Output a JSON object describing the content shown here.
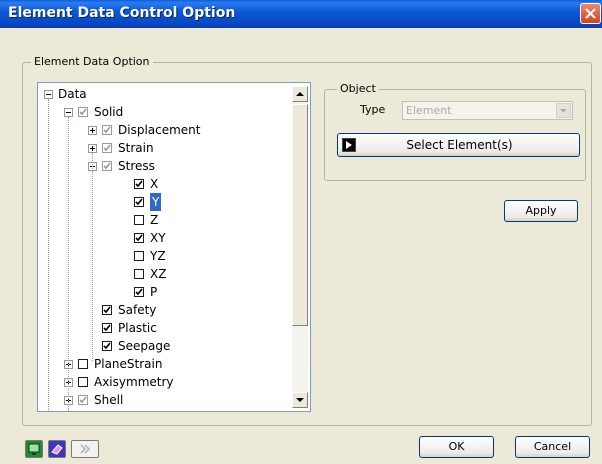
{
  "window": {
    "title": "Element Data Control Option"
  },
  "group": {
    "label": "Element Data Option"
  },
  "tree": [
    {
      "label": "Data",
      "level": 0,
      "expander": "minus",
      "checkbox": "none"
    },
    {
      "label": "Solid",
      "level": 1,
      "expander": "minus",
      "checkbox": "checked-gray"
    },
    {
      "label": "Displacement",
      "level": 2,
      "expander": "plus",
      "checkbox": "checked-gray"
    },
    {
      "label": "Strain",
      "level": 2,
      "expander": "plus",
      "checkbox": "checked-gray"
    },
    {
      "label": "Stress",
      "level": 2,
      "expander": "minus",
      "checkbox": "checked-gray"
    },
    {
      "label": "X",
      "level": 3,
      "expander": "none",
      "checkbox": "checked"
    },
    {
      "label": "Y",
      "level": 3,
      "expander": "none",
      "checkbox": "checked",
      "selected": true
    },
    {
      "label": "Z",
      "level": 3,
      "expander": "none",
      "checkbox": "unchecked"
    },
    {
      "label": "XY",
      "level": 3,
      "expander": "none",
      "checkbox": "checked"
    },
    {
      "label": "YZ",
      "level": 3,
      "expander": "none",
      "checkbox": "unchecked"
    },
    {
      "label": "XZ",
      "level": 3,
      "expander": "none",
      "checkbox": "unchecked"
    },
    {
      "label": "P",
      "level": 3,
      "expander": "none",
      "checkbox": "checked"
    },
    {
      "label": "Safety",
      "level": 2,
      "expander": "none",
      "checkbox": "checked"
    },
    {
      "label": "Plastic",
      "level": 2,
      "expander": "none",
      "checkbox": "checked"
    },
    {
      "label": "Seepage",
      "level": 2,
      "expander": "none",
      "checkbox": "checked"
    },
    {
      "label": "PlaneStrain",
      "level": 1,
      "expander": "plus",
      "checkbox": "unchecked"
    },
    {
      "label": "Axisymmetry",
      "level": 1,
      "expander": "plus",
      "checkbox": "unchecked"
    },
    {
      "label": "Shell",
      "level": 1,
      "expander": "plus",
      "checkbox": "checked-gray"
    }
  ],
  "object": {
    "label": "Object",
    "type_label": "Type",
    "type_value": "Element",
    "select_button": "Select Element(s)"
  },
  "buttons": {
    "apply": "Apply",
    "ok": "OK",
    "cancel": "Cancel"
  },
  "bottom_icons": [
    "monitor-icon",
    "eraser-icon",
    "double-chevron-right-icon"
  ],
  "colors": {
    "title_bar": "#0A58D5",
    "selection": "#316AC5",
    "face": "#ECE9D8"
  }
}
